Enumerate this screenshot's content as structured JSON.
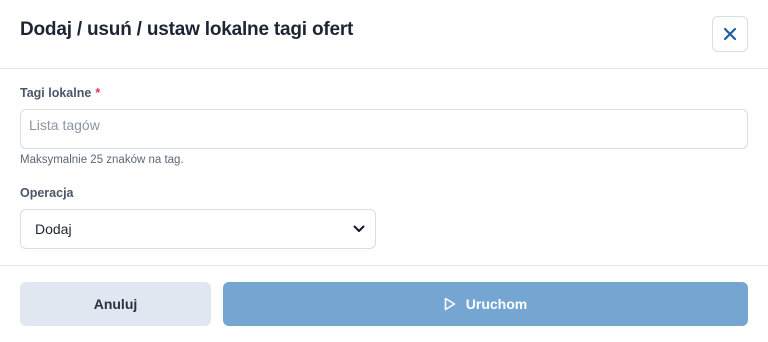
{
  "dialog": {
    "title": "Dodaj / usuń / ustaw lokalne tagi ofert",
    "close_icon": "close-icon"
  },
  "form": {
    "tags": {
      "label": "Tagi lokalne",
      "required_mark": "*",
      "value": "",
      "placeholder": "Lista tagów",
      "hint": "Maksymalnie 25 znaków na tag."
    },
    "operation": {
      "label": "Operacja",
      "selected": "Dodaj",
      "icon": "chevron-down-icon"
    }
  },
  "footer": {
    "cancel_label": "Anuluj",
    "run_label": "Uruchom",
    "run_icon": "play-icon"
  },
  "colors": {
    "accent": "#75a6d1",
    "close_icon": "#1f5f9e",
    "required": "#e0364a",
    "cancel_bg": "#e1e7f0"
  }
}
